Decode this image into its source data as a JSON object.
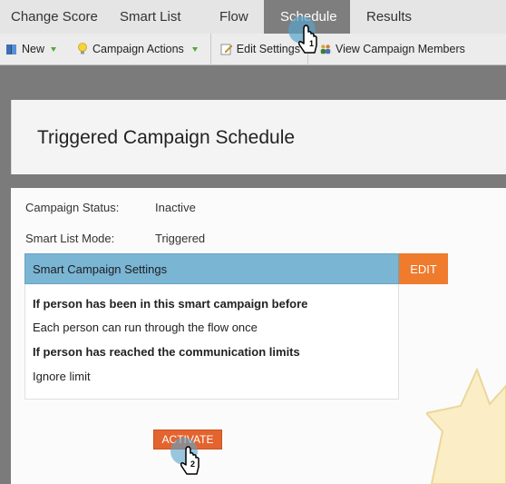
{
  "tabs": [
    {
      "label": "Change Score"
    },
    {
      "label": "Smart List"
    },
    {
      "label": "Flow"
    },
    {
      "label": "Schedule"
    },
    {
      "label": "Results"
    }
  ],
  "toolbar": {
    "new_label": "New",
    "campaign_actions_label": "Campaign Actions",
    "edit_settings_label": "Edit Settings",
    "view_members_label": "View Campaign Members"
  },
  "header": {
    "title": "Triggered Campaign Schedule"
  },
  "fields": {
    "status_label": "Campaign Status:",
    "status_value": "Inactive",
    "mode_label": "Smart List Mode:",
    "mode_value": "Triggered"
  },
  "settings": {
    "title": "Smart Campaign Settings",
    "edit_label": "EDIT",
    "heading1": "If person has been in this smart campaign before",
    "value1": "Each person can run through the flow once",
    "heading2": "If person has reached the communication limits",
    "value2": "Ignore limit"
  },
  "activate_label": "ACTIVATE",
  "step_markers": {
    "first": "1",
    "second": "2"
  },
  "colors": {
    "accent_orange": "#ef7b2d",
    "activate_orange": "#e3642f",
    "settings_blue": "#7ab5d4",
    "active_tab": "#7e7e7e"
  }
}
